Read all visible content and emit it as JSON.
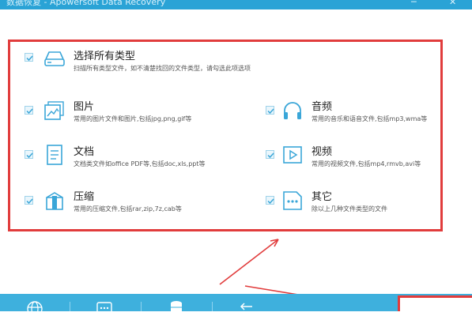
{
  "window": {
    "title": "数据恢复 - Apowersoft Data Recovery",
    "controls": [
      "─",
      "✕"
    ]
  },
  "options": [
    {
      "id": "all",
      "title": "选择所有类型",
      "desc": "扫描所有类型文件，如不清楚找回的文件类型，请勾选此项选项",
      "checked": true,
      "icon": "drive-icon"
    },
    {
      "id": "image",
      "title": "图片",
      "desc": "常用的图片文件和图片,包括jpg,png,gif等",
      "checked": true,
      "icon": "image-icon"
    },
    {
      "id": "audio",
      "title": "音频",
      "desc": "常用的音乐和语音文件,包括mp3,wma等",
      "checked": true,
      "icon": "headphones-icon"
    },
    {
      "id": "document",
      "title": "文档",
      "desc": "文档类文件如office PDF等,包括doc,xls,ppt等",
      "checked": true,
      "icon": "document-icon"
    },
    {
      "id": "video",
      "title": "视频",
      "desc": "常用的视频文件,包括mp4,rmvb,avi等",
      "checked": true,
      "icon": "video-icon"
    },
    {
      "id": "archive",
      "title": "压缩",
      "desc": "常用的压缩文件,包括rar,zip,7z,cab等",
      "checked": true,
      "icon": "archive-icon"
    },
    {
      "id": "other",
      "title": "其它",
      "desc": "除以上几种文件类型的文件",
      "checked": true,
      "icon": "more-icon"
    }
  ],
  "bottom_bar": {
    "icons": [
      "globe-icon",
      "chat-icon",
      "database-icon",
      "back-icon"
    ]
  },
  "colors": {
    "accent": "#2aa3d6",
    "highlight": "#e13c3c"
  }
}
